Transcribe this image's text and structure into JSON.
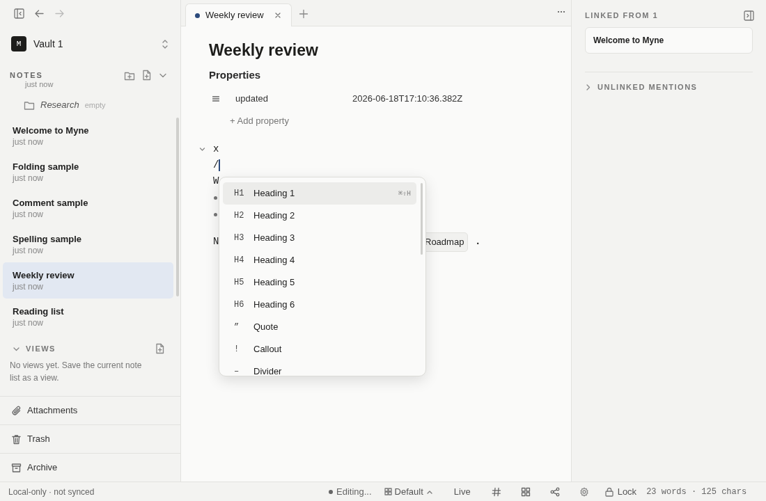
{
  "vault": {
    "initial": "M",
    "name": "Vault 1"
  },
  "notes_header": "NOTES",
  "notes": [
    {
      "kind": "time",
      "time": "just now"
    },
    {
      "kind": "folder",
      "title": "Research",
      "badge": "empty"
    },
    {
      "kind": "note",
      "title": "Welcome to Myne",
      "time": "just now",
      "selected": false
    },
    {
      "kind": "note",
      "title": "Folding sample",
      "time": "just now",
      "selected": false
    },
    {
      "kind": "note",
      "title": "Comment sample",
      "time": "just now",
      "selected": false
    },
    {
      "kind": "note",
      "title": "Spelling sample",
      "time": "just now",
      "selected": false
    },
    {
      "kind": "note",
      "title": "Weekly review",
      "time": "just now",
      "selected": true
    },
    {
      "kind": "note",
      "title": "Reading list",
      "time": "just now",
      "selected": false
    }
  ],
  "views": {
    "title": "VIEWS",
    "expanded": true,
    "empty_text": "No views yet. Save the current note list as a view."
  },
  "nav": [
    {
      "kind": "attachments",
      "label": "Attachments"
    },
    {
      "kind": "trash",
      "label": "Trash"
    },
    {
      "kind": "archive",
      "label": "Archive"
    }
  ],
  "sync_status": "Local-only · not synced",
  "tabs": [
    {
      "label": "Weekly review",
      "selected": true,
      "unsaved": true
    }
  ],
  "editor": {
    "title": "Weekly review",
    "properties_title": "Properties",
    "properties": [
      {
        "key": "updated",
        "value": "2026-06-18T17:10:36.382Z"
      }
    ],
    "add_property": "+ Add property",
    "lines": [
      {
        "kind": "fold",
        "text": "x"
      },
      {
        "kind": "cursor",
        "text": "/"
      },
      {
        "kind": "text",
        "text": "W"
      },
      {
        "kind": "bullet"
      },
      {
        "kind": "bullet"
      },
      {
        "kind": "mention",
        "text": "N",
        "chip": "Roadmap",
        "tail": "."
      }
    ]
  },
  "slash_menu": [
    {
      "glyph": "H1",
      "label": "Heading 1",
      "shortcut": "⌘⇧H",
      "selected": true
    },
    {
      "glyph": "H2",
      "label": "Heading 2",
      "selected": false
    },
    {
      "glyph": "H3",
      "label": "Heading 3",
      "selected": false
    },
    {
      "glyph": "H4",
      "label": "Heading 4",
      "selected": false
    },
    {
      "glyph": "H5",
      "label": "Heading 5",
      "selected": false
    },
    {
      "glyph": "H6",
      "label": "Heading 6",
      "selected": false
    },
    {
      "glyph": "”",
      "label": "Quote",
      "selected": false
    },
    {
      "glyph": "!",
      "label": "Callout",
      "selected": false
    },
    {
      "glyph": "–",
      "label": "Divider",
      "selected": false
    }
  ],
  "backlinks": {
    "title": "LINKED FROM 1",
    "items": [
      "Welcome to Myne"
    ],
    "unlinked": {
      "label": "UNLINKED MENTIONS",
      "expanded": false
    }
  },
  "status_bar": {
    "editing": "Editing...",
    "layout": "Default",
    "mode": "Live",
    "lock": "Lock",
    "counts": "23 words · 125 chars"
  }
}
